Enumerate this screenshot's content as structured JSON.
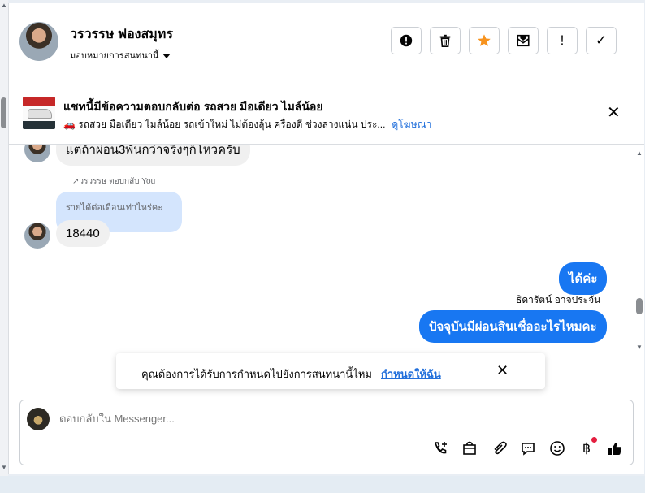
{
  "header": {
    "contact_name": "วรวรรษ ฟองสมุทร",
    "assign_label": "มอบหมายการสนทนานี้",
    "toolbar": [
      {
        "name": "report-button",
        "icon": "alert-circle-icon"
      },
      {
        "name": "delete-button",
        "icon": "trash-icon"
      },
      {
        "name": "star-button",
        "icon": "star-icon",
        "color": "#f7931e"
      },
      {
        "name": "mark-unread-button",
        "icon": "mail-icon"
      },
      {
        "name": "follow-up-button",
        "icon": "exclamation-icon",
        "glyph": "!"
      },
      {
        "name": "mark-done-button",
        "icon": "check-icon",
        "glyph": "✓"
      }
    ]
  },
  "ad": {
    "title": "แชทนี้มีข้อความตอบกลับต่อ รถสวย มือเดียว ไมล์น้อย",
    "description": "🚗 รถสวย มือเดียว ไมล์น้อย รถเข้าใหม่ ไม่ต้องลุ้น ครื่องดี ช่วงล่างแน่น ประ...",
    "link": "ดูโฆษณา",
    "close_glyph": "✕"
  },
  "thread": {
    "partial_bubble": "แต่ถ้าผ่อน3พันกว่าจริงๆก็โหวครับ",
    "reply_meta": "↗วรวรรษ ตอบกลับ You",
    "quoted_text": "รายได้ต่อเดือนเท่าไหร่คะ",
    "incoming_reply": "18440",
    "outgoing_1": "ได้ค่ะ",
    "sender_name": "ธิดารัตน์ อาจประจัน",
    "outgoing_2": "ปัจจุบันมีผ่อนสินเชื่ออะไรไหมคะ"
  },
  "toast": {
    "text": "คุณต้องการได้รับการกำหนดไปยังการสนทนานี้ไหม",
    "link": "กำหนดให้ฉัน",
    "close_glyph": "✕"
  },
  "composer": {
    "placeholder": "ตอบกลับใน Messenger...",
    "icons": [
      "phone-plus-icon",
      "shopping-bag-icon",
      "paperclip-icon",
      "chat-bubble-icon",
      "smiley-icon",
      "baht-icon",
      "thumbs-up-icon"
    ],
    "baht_glyph": "฿"
  },
  "colors": {
    "accent": "#1877f2",
    "link": "#216fdb",
    "quote_bg": "#d4e5fd",
    "incoming_bg": "#f0f0f0",
    "star": "#f7931e"
  }
}
